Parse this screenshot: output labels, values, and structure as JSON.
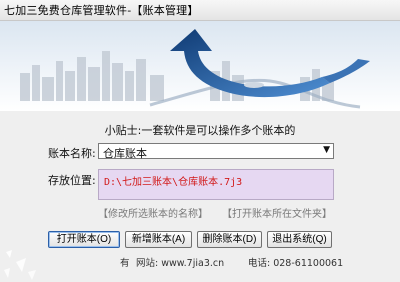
{
  "window": {
    "title": "七加三免费仓库管理软件-【账本管理】"
  },
  "tip": "小贴士:一套软件是可以操作多个账本的",
  "form": {
    "account_label": "账本名称:",
    "account_value": "仓库账本",
    "path_label": "存放位置:",
    "path_value": "D:\\七加三账本\\仓库账本.7j3"
  },
  "links": {
    "rename": "【修改所选账本的名称】",
    "open_folder": "【打开账本所在文件夹】"
  },
  "buttons": {
    "open": "打开账本(O)",
    "new": "新增账本(A)",
    "delete": "删除账本(D)",
    "exit": "退出系统(Q)"
  },
  "footer": {
    "prefix": "有",
    "website": "网站: www.7jia3.cn",
    "phone": "电话: 028-61100061"
  },
  "colors": {
    "path_text": "#d21a1a",
    "path_bg": "#e6d8f2",
    "banner_arrow": "#1d4f8c"
  }
}
